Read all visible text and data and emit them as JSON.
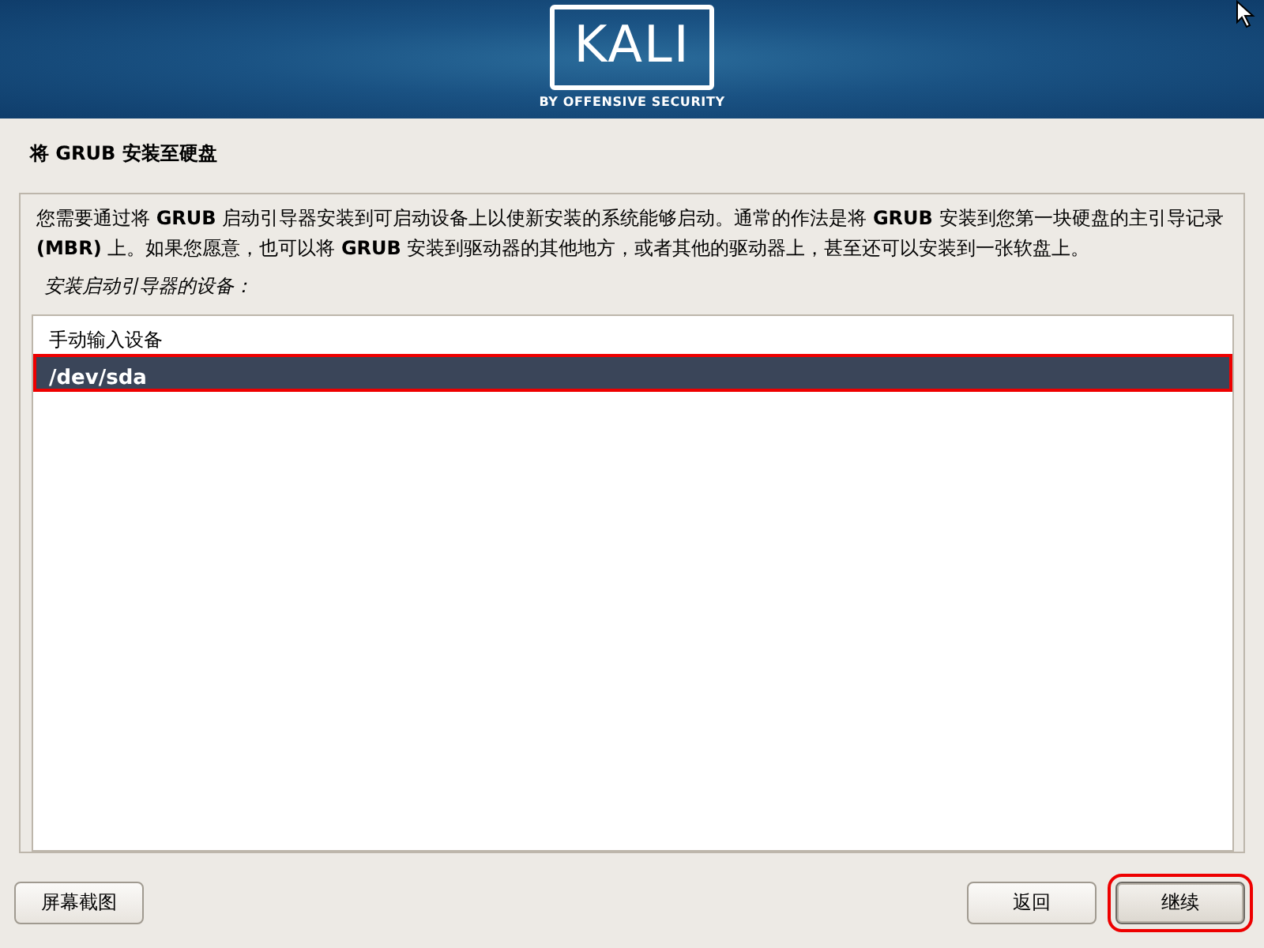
{
  "header": {
    "logo": "KALI",
    "tagline": "BY OFFENSIVE SECURITY"
  },
  "title": "将 GRUB 安装至硬盘",
  "description": "您需要通过将 **GRUB** 启动引导器安装到可启动设备上以使新安装的系统能够启动。通常的作法是将 **GRUB** 安装到您第一块硬盘的主引导记录 **(MBR)** 上。如果您愿意，也可以将 **GRUB** 安装到驱动器的其他地方，或者其他的驱动器上，甚至还可以安装到一张软盘上。",
  "prompt": "安装启动引导器的设备：",
  "devices": [
    {
      "label": "手动输入设备",
      "selected": false
    },
    {
      "label": "/dev/sda",
      "selected": true
    }
  ],
  "buttons": [
    {
      "label": "屏幕截图",
      "focused": false
    },
    {
      "label": "返回",
      "focused": false
    },
    {
      "label": "继续",
      "focused": true
    }
  ]
}
